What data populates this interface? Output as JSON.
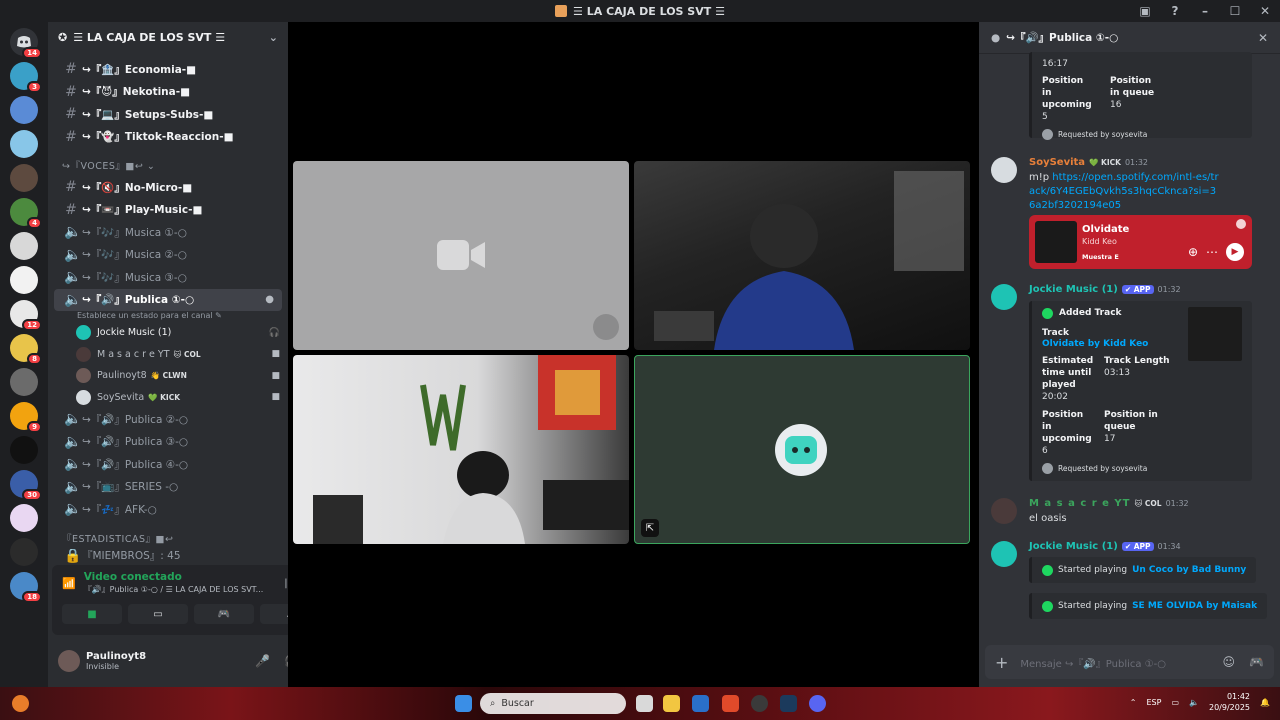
{
  "window": {
    "title": "☰ LA CAJA DE LOS SVT ☰",
    "controls": [
      "▣",
      "?",
      "–",
      "☐",
      "✕"
    ]
  },
  "server_rail": {
    "dm_badge": "14",
    "servers": [
      {
        "color": "#3aa0c8",
        "badge": "3"
      },
      {
        "color": "#5a8bd6",
        "badge": ""
      },
      {
        "color": "#88c6e8",
        "badge": ""
      },
      {
        "color": "#5d4a3f",
        "badge": ""
      },
      {
        "color": "#4c8a3e",
        "badge": "4"
      },
      {
        "color": "#d8d8d8",
        "badge": ""
      },
      {
        "color": "#f2f2f2",
        "badge": ""
      },
      {
        "color": "#e8e8e8",
        "badge": "12"
      },
      {
        "color": "#e8c44a",
        "badge": "8"
      },
      {
        "color": "#6b6b6b",
        "badge": ""
      },
      {
        "color": "#f2a30f",
        "badge": "9"
      },
      {
        "color": "#111111",
        "badge": ""
      },
      {
        "color": "#3a5ea8",
        "badge": "30"
      },
      {
        "color": "#e9d7f2",
        "badge": ""
      },
      {
        "color": "#2b2b2b",
        "badge": ""
      },
      {
        "color": "#4a89c8",
        "badge": "18"
      }
    ]
  },
  "sidebar": {
    "server_name": "☰ LA CAJA DE LOS SVT ☰",
    "channels_top": [
      {
        "icon": "#",
        "name": "↪『🏦』Economia-■"
      },
      {
        "icon": "#",
        "name": "↪『😈』Nekotina-■"
      },
      {
        "icon": "#",
        "name": "↪『💻』Setups-Subs-■"
      },
      {
        "icon": "#",
        "name": "↪『👻』Tiktok-Reaccion-■"
      }
    ],
    "voces_category": "↪『VOCES』■↩ ⌄",
    "channels_voice_text": [
      {
        "icon": "#",
        "name": "↪『🔇』No-Micro-■"
      },
      {
        "icon": "#",
        "name": "↪『📼』Play-Music-■"
      }
    ],
    "voice_channels": [
      {
        "name": "↪『🎶』Musica ①-○"
      },
      {
        "name": "↪『🎶』Musica ②-○"
      },
      {
        "name": "↪『🎶』Musica ③-○"
      }
    ],
    "active_channel": {
      "name": "↪『🔊』Publica ①-○",
      "status": "Establece un estado para el canal ✎"
    },
    "voice_users": [
      {
        "name": "Jockie Music (1)",
        "tag": "",
        "color": "#1ec3b4"
      },
      {
        "name": "M a s a c r e YT",
        "tag": "🐱 COL",
        "color": "#4a3a3a"
      },
      {
        "name": "Paulinoyt8",
        "tag": "👋 CLWN",
        "color": "#6d5a57"
      },
      {
        "name": "SoySevita",
        "tag": "💚 KICK",
        "color": "#d7dce0"
      }
    ],
    "voice_channels_after": [
      {
        "name": "↪『🔊』Publica ②-○"
      },
      {
        "name": "↪『🔊』Publica ③-○"
      },
      {
        "name": "↪『🔊』Publica ④-○"
      },
      {
        "name": "↪『📺』SERIES -○"
      },
      {
        "name": "↪『💤』AFK-○"
      }
    ],
    "stats_category": "『ESTADISTICAS』■↩",
    "stats_channel": "『MIEMBROS』: 45"
  },
  "voice_panel": {
    "title": "Video conectado",
    "subtitle": "『🔊』Publica ①-○ / ☰ LA CAJA DE LOS SVT..."
  },
  "user_panel": {
    "name": "Paulinoyt8",
    "status": "Invisible"
  },
  "chat": {
    "header": "↪『🔊』Publica ①-○",
    "first_embed": {
      "time_value": "16:17",
      "pos_upcoming_label": "Position in upcoming",
      "pos_upcoming_value": "5",
      "pos_queue_label": "Position in queue",
      "pos_queue_value": "16",
      "requested": "Requested by soysevita"
    },
    "msg_soysevita": {
      "author": "SoySevita",
      "tag": "💚 KICK",
      "time": "01:32",
      "cmd": "m!p ",
      "link": "https://open.spotify.com/intl-es/track/6Y4EGEbQvkh5s3hqcCknca?si=36a2bf3202194e05"
    },
    "spotify_card": {
      "title": "Olvidate",
      "artist": "Kidd Keo",
      "preview": "Muestra  E"
    },
    "msg_jockie1": {
      "author": "Jockie Music (1)",
      "badge": "✔ APP",
      "time": "01:32",
      "embed_title": "Added Track",
      "track_label": "Track",
      "track_value": "Olvidate by Kidd Keo",
      "est_label": "Estimated time until played",
      "est_value": "20:02",
      "len_label": "Track Length",
      "len_value": "03:13",
      "pos_upcoming_label": "Position in upcoming",
      "pos_upcoming_value": "6",
      "pos_queue_label": "Position in queue",
      "pos_queue_value": "17",
      "requested": "Requested by soysevita"
    },
    "msg_masacre": {
      "author": "M a s a c r e YT",
      "tag": "🐱 COL",
      "time": "01:32",
      "text": "el oasis"
    },
    "msg_jockie2": {
      "author": "Jockie Music (1)",
      "badge": "✔ APP",
      "time": "01:34",
      "played1_prefix": "Started playing",
      "played1_link": "Un Coco by Bad Bunny",
      "played2_prefix": "Started playing",
      "played2_link": "SE ME OLVIDA by Maisak"
    },
    "input_placeholder": "Mensaje ↪『🔊』Publica ①-○"
  },
  "taskbar": {
    "search_label": "Buscar",
    "lang": "ESP",
    "time": "01:42",
    "date": "20/9/2025"
  }
}
